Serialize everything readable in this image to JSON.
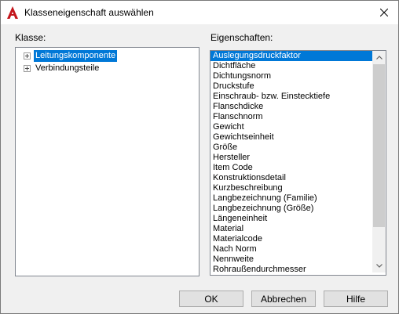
{
  "window": {
    "title": "Klasseneigenschaft auswählen"
  },
  "left": {
    "label": "Klasse:",
    "tree": [
      {
        "label": "Leitungskomponente",
        "selected": true
      },
      {
        "label": "Verbindungsteile",
        "selected": false
      }
    ]
  },
  "right": {
    "label": "Eigenschaften:",
    "items": [
      "Auslegungsdruckfaktor",
      "Dichtfläche",
      "Dichtungsnorm",
      "Druckstufe",
      "Einschraub- bzw. Einstecktiefe",
      "Flanschdicke",
      "Flanschnorm",
      "Gewicht",
      "Gewichtseinheit",
      "Größe",
      "Hersteller",
      "Item Code",
      "Konstruktionsdetail",
      "Kurzbeschreibung",
      "Langbezeichnung (Familie)",
      "Langbezeichnung (Größe)",
      "Längeneinheit",
      "Material",
      "Materialcode",
      "Nach Norm",
      "Nennweite",
      "Rohraußendurchmesser"
    ],
    "selected_index": 0
  },
  "buttons": {
    "ok": "OK",
    "cancel": "Abbrechen",
    "help": "Hilfe"
  },
  "colors": {
    "selection": "#0078d7",
    "app_icon": "#c4161c"
  }
}
